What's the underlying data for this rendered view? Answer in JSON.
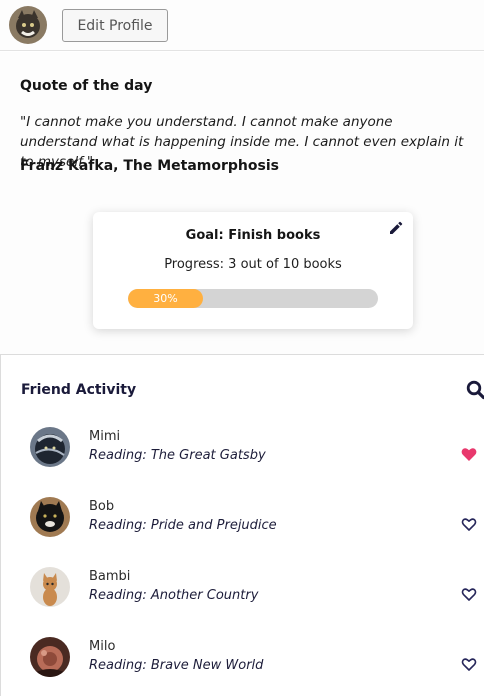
{
  "header": {
    "edit_profile_label": "Edit Profile"
  },
  "quote": {
    "heading": "Quote of the day",
    "text": "\"I cannot make you understand. I cannot make anyone understand what is happening inside me. I cannot even explain it to myself.\"",
    "author": "Franz Kafka, The Metamorphosis"
  },
  "goal": {
    "title": "Goal: Finish books",
    "progress_text": "Progress: 3 out of 10 books",
    "progress_percent": 30,
    "progress_label": "30%",
    "bar_color": "#ffb040"
  },
  "activity": {
    "title": "Friend Activity",
    "friends": [
      {
        "name": "Mimi",
        "reading": "Reading: The Great Gatsby",
        "liked": true,
        "heart_color": "#e8386d"
      },
      {
        "name": "Bob",
        "reading": "Reading: Pride and Prejudice",
        "liked": false,
        "heart_color": "#26265a"
      },
      {
        "name": "Bambi",
        "reading": "Reading: Another Country",
        "liked": false,
        "heart_color": "#26265a"
      },
      {
        "name": "Milo",
        "reading": "Reading: Brave New World",
        "liked": false,
        "heart_color": "#26265a"
      }
    ]
  }
}
